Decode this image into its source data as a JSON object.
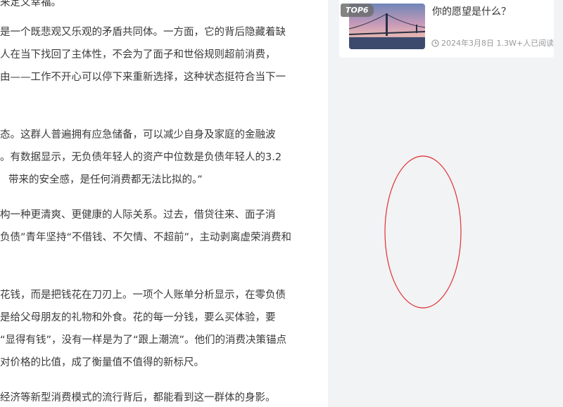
{
  "article": {
    "lines": [
      "来定义幸福。",
      "是一个既悲观又乐观的矛盾共同体。一方面，它的背后隐藏着缺",
      "人在当下找回了主体性，不会为了面子和世俗规则超前消费，",
      "由——工作不开心可以停下来重新选择，这种状态挺符合当下一",
      "态。这群人普遍拥有应急储备，可以减少自身及家庭的金融波",
      "。有数据显示，无负债年轻人的资产中位数是负债年轻人的3.2",
      "带来的安全感，是任何消费都无法比拟的。”",
      "构一种更清爽、更健康的人际关系。过去，借贷往来、面子消",
      "负债”青年坚持“不借钱、不欠情、不超前”，主动剥离虚荣消费和",
      "花钱，而是把钱花在刀刃上。一项个人账单分析显示，在零负债",
      "是给父母朋友的礼物和外食。花的每一分钱，要么买体验，要",
      "“显得有钱”，没有一样是为了“跟上潮流”。他们的消费决策锚点",
      "对价格的比值，成了衡量值不值得的新标尺。",
      "经济等新型消费模式的流行背后，都能看到这一群体的身影。"
    ]
  },
  "sidebar": {
    "hot_item": {
      "rank": "TOP6",
      "title": "你的愿望是什么？",
      "meta": "2024年3月8日 1.3W+人已阅读",
      "icon": "clock-icon"
    }
  },
  "colors": {
    "sidebar_bg": "#f2f3f5",
    "text": "#3a3a3a",
    "meta": "#999999",
    "annotation": "#e03030"
  }
}
